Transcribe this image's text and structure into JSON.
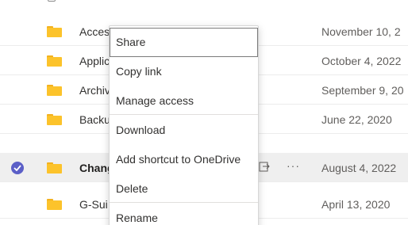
{
  "rows": [
    {
      "name": "Acces",
      "date": "November 10, 2"
    },
    {
      "name": "Applic",
      "date": "October 4, 2022"
    },
    {
      "name": "Archiv",
      "date": "September 9, 20"
    },
    {
      "name": "Backu",
      "date": "June 22, 2020"
    },
    {
      "name": "Chang",
      "date": "August 4, 2022",
      "more": "···"
    },
    {
      "name": "G-Sui",
      "date": "April 13, 2020"
    }
  ],
  "context_menu": {
    "items": [
      {
        "label": "Share"
      },
      {
        "label": "Copy link"
      },
      {
        "label": "Manage access"
      },
      {
        "label": "Download"
      },
      {
        "label": "Add shortcut to OneDrive"
      },
      {
        "label": "Delete"
      },
      {
        "label": "Rename"
      }
    ]
  },
  "colors": {
    "accent": "#5b5fc7",
    "folder": "#fcc32b",
    "selected_row": "#efefef"
  }
}
